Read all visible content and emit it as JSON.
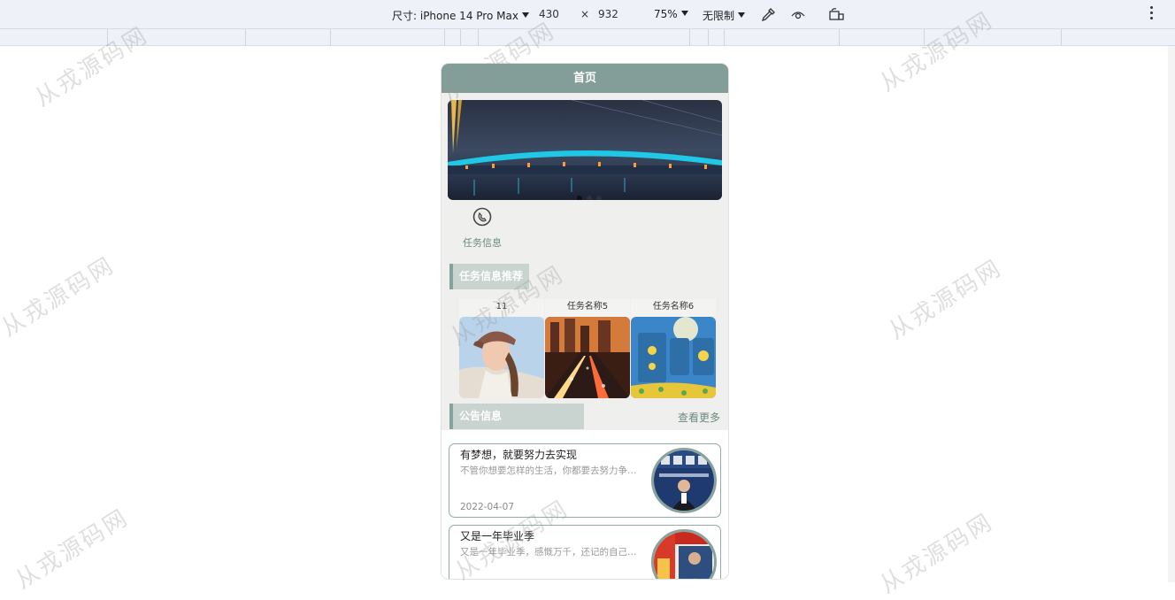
{
  "devtools": {
    "device_label": "尺寸: iPhone 14 Pro Max",
    "width": "430",
    "times": "×",
    "height": "932",
    "zoom": "75%",
    "throttle": "无限制"
  },
  "page": {
    "header_title": "首页",
    "banner": {
      "dots": 3,
      "active_dot": 0
    },
    "quick_links": [
      {
        "label": "任务信息",
        "icon": "phone-icon"
      }
    ],
    "recommend_title": "任务信息推荐",
    "recommend_cards": [
      {
        "title": "11",
        "image": "woman-in-cap-photo"
      },
      {
        "title": "任务名称5",
        "image": "city-night-traffic-photo"
      },
      {
        "title": "任务名称6",
        "image": "weather-app-photo"
      }
    ],
    "notice_title": "公告信息",
    "more_label": "查看更多",
    "notices": [
      {
        "title": "有梦想，就要努力去实现",
        "desc": "不管你想要怎样的生活，你都要去努力争取，不多尝试一些事情怎么知道自己适合什么、不适合什么呢？",
        "date": "2022-04-07",
        "image": "press-conference-photo"
      },
      {
        "title": "又是一年毕业季",
        "desc": "又是一年毕业季，感慨万千，还记的自己当年毕业时的情景",
        "date": "",
        "image": "magazine-cover-photo"
      }
    ]
  },
  "watermark_text": "从戎源码网",
  "colors": {
    "header": "#839e98",
    "accent": "#85a39c",
    "section_bg": "#c9d3d0",
    "link": "#6a8a82"
  }
}
